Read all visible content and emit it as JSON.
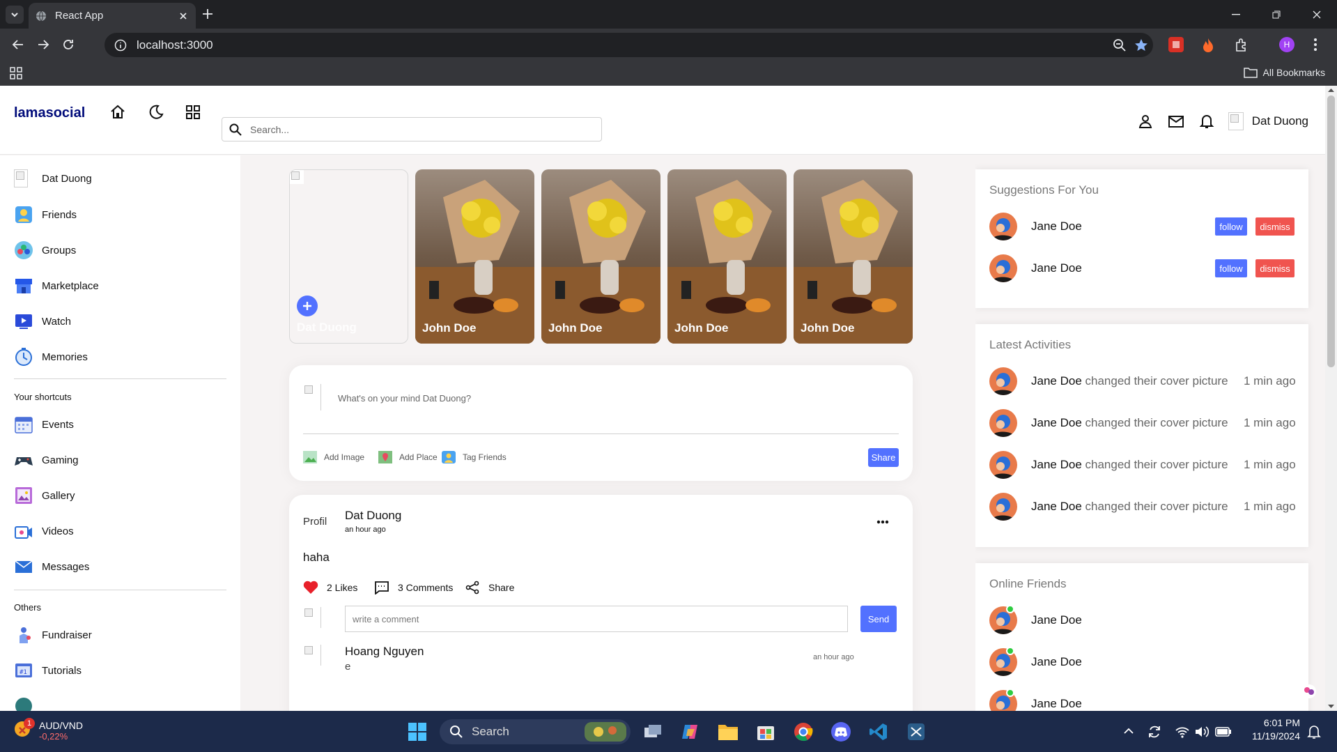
{
  "browser": {
    "tab_title": "React App",
    "url": "localhost:3000",
    "profile_initial": "H",
    "all_bookmarks": "All Bookmarks"
  },
  "app": {
    "logo": "lamasocial",
    "search_placeholder": "Search...",
    "user_name": "Dat Duong"
  },
  "left_menu": {
    "main": [
      {
        "label": "Dat Duong",
        "icon": "avatar-broken"
      },
      {
        "label": "Friends",
        "icon": "friends-icon"
      },
      {
        "label": "Groups",
        "icon": "groups-icon"
      },
      {
        "label": "Marketplace",
        "icon": "marketplace-icon"
      },
      {
        "label": "Watch",
        "icon": "watch-icon"
      },
      {
        "label": "Memories",
        "icon": "memories-icon"
      }
    ],
    "shortcuts_title": "Your shortcuts",
    "shortcuts": [
      {
        "label": "Events",
        "icon": "events-icon"
      },
      {
        "label": "Gaming",
        "icon": "gaming-icon"
      },
      {
        "label": "Gallery",
        "icon": "gallery-icon"
      },
      {
        "label": "Videos",
        "icon": "videos-icon"
      },
      {
        "label": "Messages",
        "icon": "messages-icon"
      }
    ],
    "others_title": "Others",
    "others": [
      {
        "label": "Fundraiser",
        "icon": "fundraiser-icon"
      },
      {
        "label": "Tutorials",
        "icon": "tutorials-icon"
      }
    ]
  },
  "stories": {
    "own_name": "Dat Duong",
    "items": [
      "John Doe",
      "John Doe",
      "John Doe",
      "John Doe"
    ]
  },
  "composer": {
    "placeholder": "What's on your mind Dat Duong?",
    "add_image": "Add Image",
    "add_place": "Add Place",
    "tag_friends": "Tag Friends",
    "share": "Share"
  },
  "post": {
    "author": "Dat Duong",
    "time": "an hour ago",
    "avatar_alt": "Profil",
    "text": "haha",
    "likes": "2 Likes",
    "comments": "3 Comments",
    "share": "Share",
    "comment_placeholder": "write a comment",
    "send": "Send",
    "comment": {
      "author": "Hoang Nguyen",
      "text": "e",
      "time": "an hour ago"
    }
  },
  "suggestions": {
    "title": "Suggestions For You",
    "items": [
      {
        "name": "Jane Doe",
        "follow": "follow",
        "dismiss": "dismiss"
      },
      {
        "name": "Jane Doe",
        "follow": "follow",
        "dismiss": "dismiss"
      }
    ]
  },
  "activities": {
    "title": "Latest Activities",
    "items": [
      {
        "name": "Jane Doe",
        "action": "changed their cover picture",
        "time": "1 min ago"
      },
      {
        "name": "Jane Doe",
        "action": "changed their cover picture",
        "time": "1 min ago"
      },
      {
        "name": "Jane Doe",
        "action": "changed their cover picture",
        "time": "1 min ago"
      },
      {
        "name": "Jane Doe",
        "action": "changed their cover picture",
        "time": "1 min ago"
      }
    ]
  },
  "online": {
    "title": "Online Friends",
    "items": [
      "Jane Doe",
      "Jane Doe",
      "Jane Doe"
    ]
  },
  "taskbar": {
    "ticker_name": "AUD/VND",
    "ticker_change": "-0,22%",
    "ticker_badge": "1",
    "search": "Search",
    "time": "6:01 PM",
    "date": "11/19/2024"
  },
  "colors": {
    "logo": "#000b7a",
    "follow": "#5271ff",
    "dismiss": "#f0544f",
    "like": "#e8202a",
    "online": "#2ecc40"
  }
}
